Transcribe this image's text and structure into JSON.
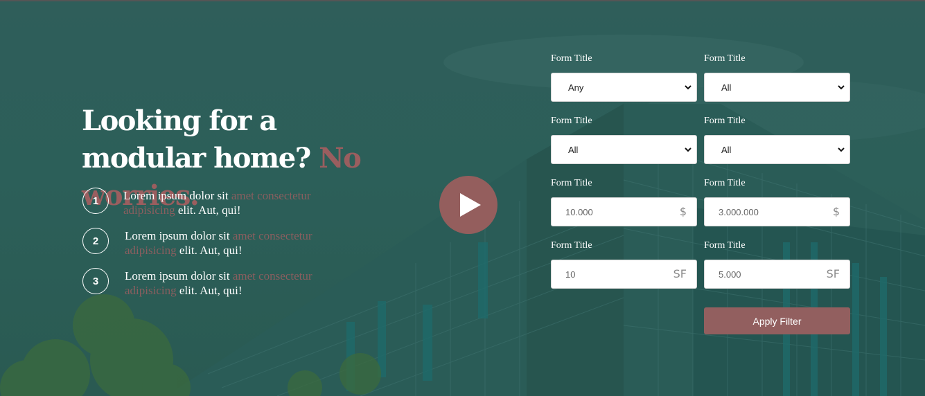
{
  "hero": {
    "headline_main": "Looking for a modular home?",
    "headline_accent": "No worries."
  },
  "steps": [
    {
      "number": "1",
      "text_a": "Lorem ipsum dolor sit",
      "text_muted": "amet consectetur adipisicing",
      "text_b": "elit. Aut, qui!"
    },
    {
      "number": "2",
      "text_a": "Lorem ipsum dolor sit",
      "text_muted": "amet consectetur adipisicing",
      "text_b": "elit. Aut, qui!"
    },
    {
      "number": "3",
      "text_a": "Lorem ipsum dolor sit",
      "text_muted": "amet consectetur adipisicing",
      "text_b": "elit. Aut, qui!"
    }
  ],
  "play_icon": "play-icon",
  "form": {
    "fields": [
      {
        "label": "Form Title",
        "type": "select",
        "value": "Any"
      },
      {
        "label": "Form Title",
        "type": "select",
        "value": "All"
      },
      {
        "label": "Form Title",
        "type": "select",
        "value": "All"
      },
      {
        "label": "Form Title",
        "type": "select",
        "value": "All"
      },
      {
        "label": "Form Title",
        "type": "input",
        "value": "10.000",
        "unit": "$"
      },
      {
        "label": "Form Title",
        "type": "input",
        "value": "3.000.000",
        "unit": "$"
      },
      {
        "label": "Form Title",
        "type": "input",
        "value": "10",
        "unit": "SF"
      },
      {
        "label": "Form Title",
        "type": "input",
        "value": "5.000",
        "unit": "SF"
      }
    ],
    "apply_label": "Apply Filter"
  },
  "colors": {
    "overlay": "#2c5f59",
    "accent": "#945e5d",
    "text": "#ffffff"
  }
}
